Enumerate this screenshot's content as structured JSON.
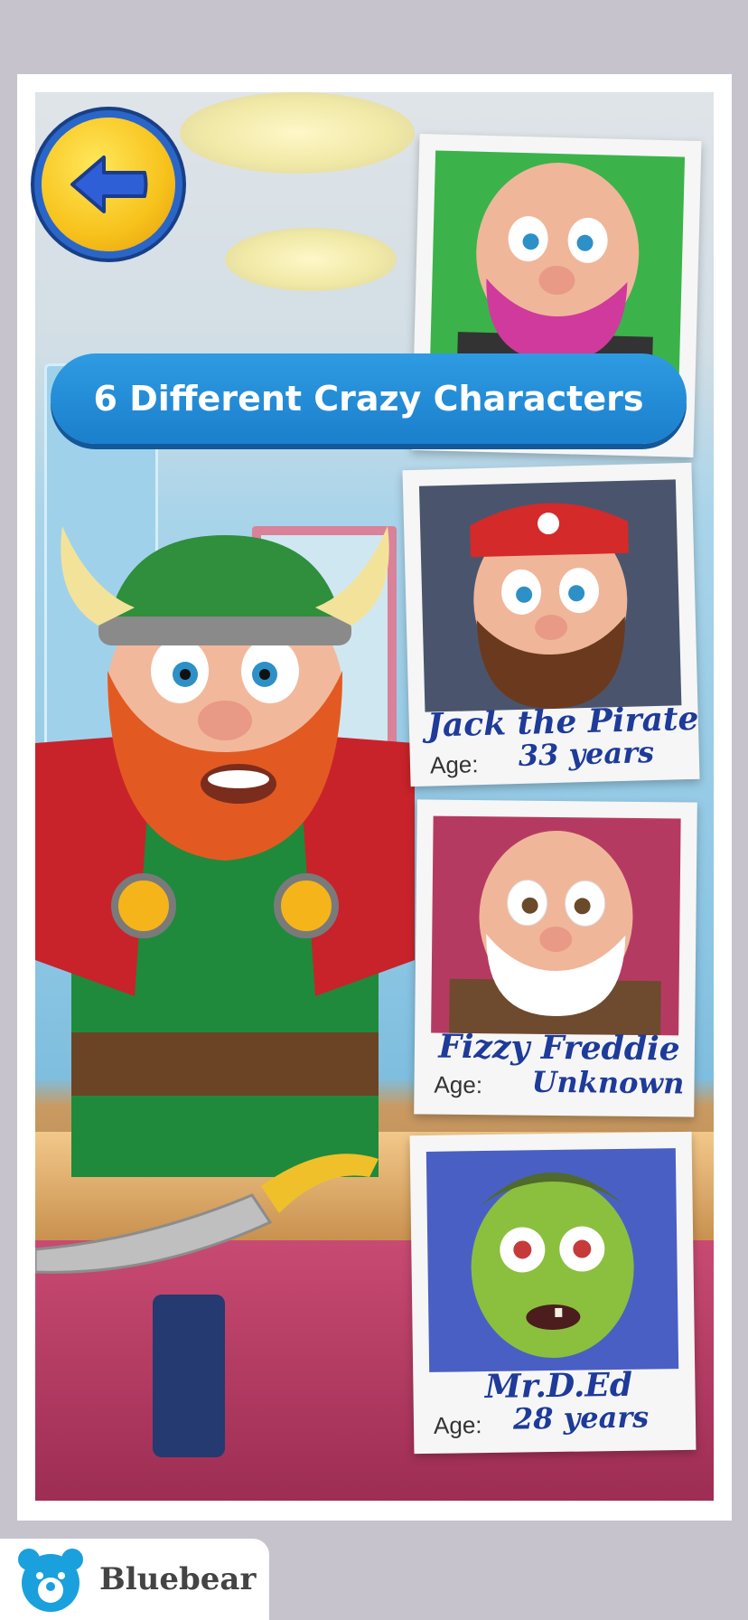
{
  "banner": {
    "text": "6 Different Crazy Characters"
  },
  "back_button": {
    "icon": "back-arrow-icon"
  },
  "cards": [
    {
      "name": "",
      "age_label": "",
      "age_value": ""
    },
    {
      "name": "Jack the Pirate",
      "age_label": "Age:",
      "age_value": "33 years"
    },
    {
      "name": "Fizzy Freddie",
      "age_label": "Age:",
      "age_value": "Unknown"
    },
    {
      "name": "Mr.D.Ed",
      "age_label": "Age:",
      "age_value": "28 years"
    }
  ],
  "branding": {
    "logo_text": "Bluebear",
    "logo_icon": "bear-icon"
  },
  "colors": {
    "banner_blue": "#1b7fcc",
    "name_blue": "#1e3b9a",
    "back_yellow": "#f7c21b"
  }
}
